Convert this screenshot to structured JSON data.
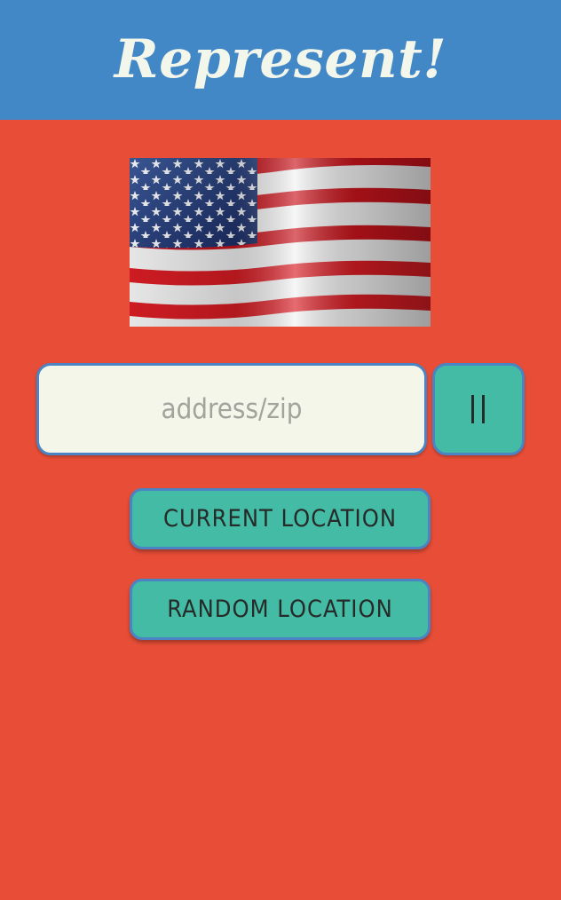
{
  "header": {
    "title": "Represent!"
  },
  "flag": {
    "icon": "us-flag-icon"
  },
  "search": {
    "value": "",
    "placeholder": "address/zip",
    "go_icon": "pause-bars-icon"
  },
  "actions": {
    "current_location_label": "CURRENT LOCATION",
    "random_location_label": "RANDOM LOCATION"
  },
  "colors": {
    "background": "#E84E37",
    "header": "#4287C6",
    "button": "#44BBA4",
    "input": "#F4F6EA",
    "border": "#4A84C4"
  }
}
